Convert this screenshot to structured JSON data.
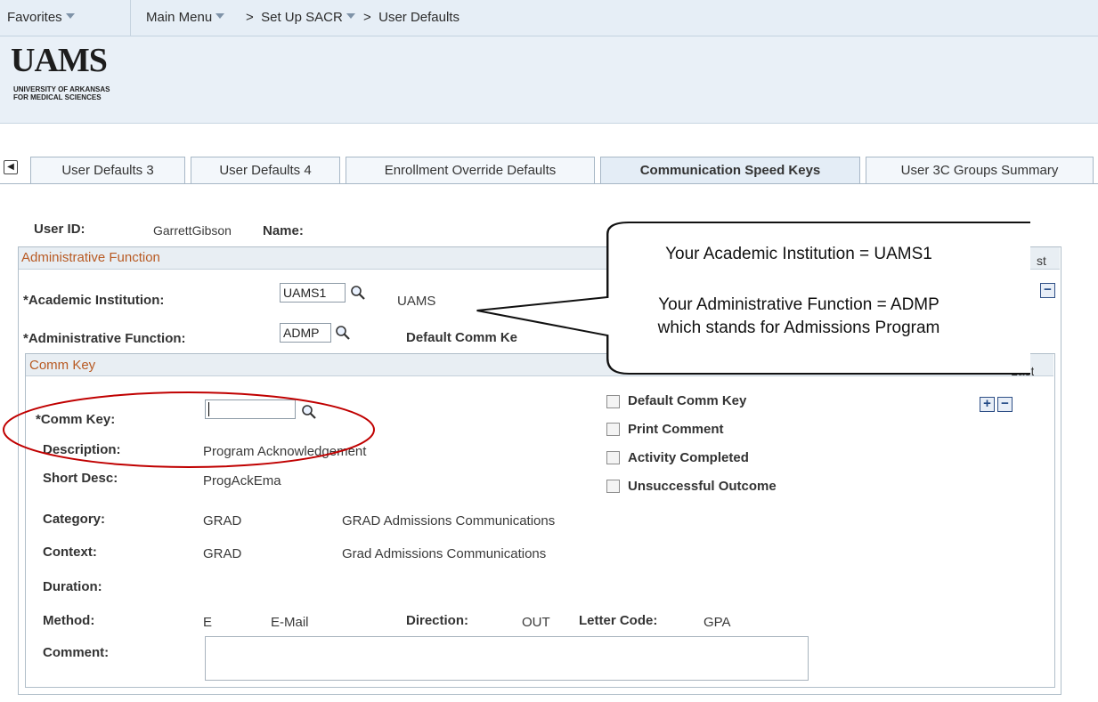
{
  "nav": {
    "favorites": "Favorites",
    "main_menu": "Main Menu",
    "crumb1": "Set Up SACR",
    "crumb2": "User Defaults"
  },
  "logo": {
    "name": "UAMS",
    "sub_line1": "UNIVERSITY OF ARKANSAS",
    "sub_line2": "FOR MEDICAL SCIENCES"
  },
  "tabs": [
    {
      "label": "User Defaults 3"
    },
    {
      "label": "User Defaults 4"
    },
    {
      "label": "Enrollment Override Defaults"
    },
    {
      "label": "Communication Speed Keys",
      "active": true
    },
    {
      "label": "User 3C Groups Summary"
    }
  ],
  "user": {
    "id_label": "User ID:",
    "id_value": "GarrettGibson",
    "name_label": "Name:"
  },
  "admin": {
    "section_title": "Administrative Function",
    "header_last": "st",
    "acad_label": "*Academic Institution:",
    "acad_value": "UAMS1",
    "acad_desc": "UAMS",
    "func_label": "*Administrative Function:",
    "func_value": "ADMP",
    "default_comm_key_label": "Default Comm Ke"
  },
  "comm": {
    "section_title": "Comm Key",
    "header_right": "Last",
    "key_label": "*Comm Key:",
    "key_value": "",
    "desc_label": "Description:",
    "desc_value": "Program Acknowledgement",
    "short_label": "Short Desc:",
    "short_value": "ProgAckEma",
    "category_label": "Category:",
    "category_code": "GRAD",
    "category_desc": "GRAD Admissions Communications",
    "context_label": "Context:",
    "context_code": "GRAD",
    "context_desc": "Grad Admissions Communications",
    "duration_label": "Duration:",
    "method_label": "Method:",
    "method_code": "E",
    "method_desc": "E-Mail",
    "direction_label": "Direction:",
    "direction_value": "OUT",
    "letter_label": "Letter Code:",
    "letter_value": "GPA",
    "comment_label": "Comment:",
    "checkboxes": [
      {
        "label": "Default Comm Key",
        "checked": false
      },
      {
        "label": "Print Comment",
        "checked": false
      },
      {
        "label": "Activity Completed",
        "checked": false
      },
      {
        "label": "Unsuccessful Outcome",
        "checked": false
      }
    ]
  },
  "callout": {
    "line1": "Your Academic Institution = UAMS1",
    "line2": "Your Administrative Function = ADMP",
    "line3": "which stands for Admissions Program"
  },
  "colors": {
    "section_title": "#b85a23",
    "annotation_circle": "#c00000",
    "tab_border": "#a7b7c6",
    "nav_bg": "#e6eef6"
  }
}
